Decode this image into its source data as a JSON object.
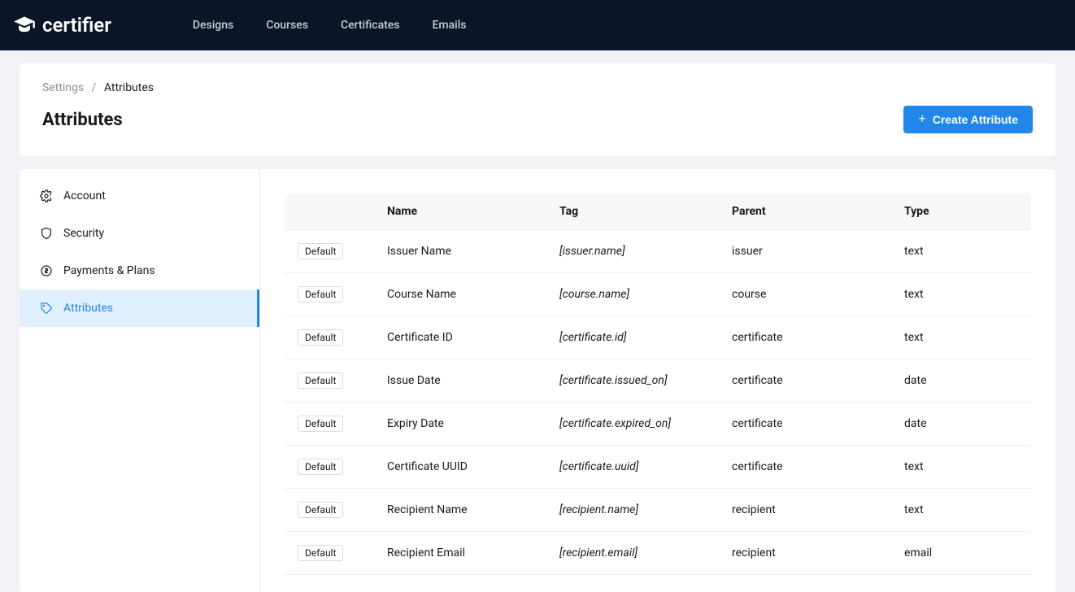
{
  "brand": {
    "name": "certifier"
  },
  "nav": {
    "items": [
      {
        "label": "Designs"
      },
      {
        "label": "Courses"
      },
      {
        "label": "Certificates"
      },
      {
        "label": "Emails"
      }
    ]
  },
  "breadcrumb": {
    "parent": "Settings",
    "current": "Attributes"
  },
  "page": {
    "title": "Attributes",
    "create_button": "Create Attribute"
  },
  "sidebar": {
    "items": [
      {
        "label": "Account"
      },
      {
        "label": "Security"
      },
      {
        "label": "Payments & Plans"
      },
      {
        "label": "Attributes"
      }
    ]
  },
  "table": {
    "headers": {
      "name": "Name",
      "tag": "Tag",
      "parent": "Parent",
      "type": "Type"
    },
    "rows": [
      {
        "badge": "Default",
        "name": "Issuer Name",
        "tag": "[issuer.name]",
        "parent": "issuer",
        "type": "text"
      },
      {
        "badge": "Default",
        "name": "Course Name",
        "tag": "[course.name]",
        "parent": "course",
        "type": "text"
      },
      {
        "badge": "Default",
        "name": "Certificate ID",
        "tag": "[certificate.id]",
        "parent": "certificate",
        "type": "text"
      },
      {
        "badge": "Default",
        "name": "Issue Date",
        "tag": "[certificate.issued_on]",
        "parent": "certificate",
        "type": "date"
      },
      {
        "badge": "Default",
        "name": "Expiry Date",
        "tag": "[certificate.expired_on]",
        "parent": "certificate",
        "type": "date"
      },
      {
        "badge": "Default",
        "name": "Certificate UUID",
        "tag": "[certificate.uuid]",
        "parent": "certificate",
        "type": "text"
      },
      {
        "badge": "Default",
        "name": "Recipient Name",
        "tag": "[recipient.name]",
        "parent": "recipient",
        "type": "text"
      },
      {
        "badge": "Default",
        "name": "Recipient Email",
        "tag": "[recipient.email]",
        "parent": "recipient",
        "type": "email"
      }
    ]
  }
}
